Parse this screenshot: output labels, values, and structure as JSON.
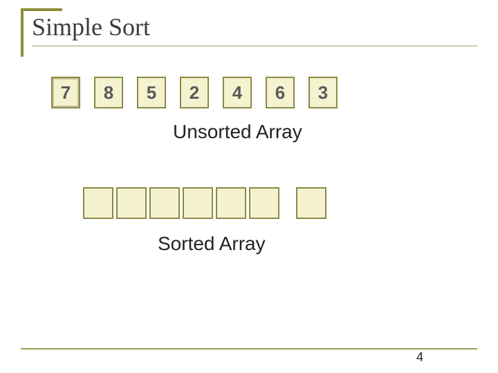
{
  "title": "Simple Sort",
  "unsorted": {
    "label": "Unsorted Array",
    "values": [
      "7",
      "8",
      "5",
      "2",
      "4",
      "6",
      "3"
    ]
  },
  "sorted": {
    "label": "Sorted Array",
    "values": [
      "",
      "",
      "",
      "",
      "",
      "",
      ""
    ]
  },
  "page": "4",
  "chart_data": {
    "type": "table",
    "title": "Simple Sort",
    "series": [
      {
        "name": "Unsorted Array",
        "values": [
          7,
          8,
          5,
          2,
          4,
          6,
          3
        ]
      },
      {
        "name": "Sorted Array",
        "values": [
          null,
          null,
          null,
          null,
          null,
          null,
          null
        ]
      }
    ]
  }
}
